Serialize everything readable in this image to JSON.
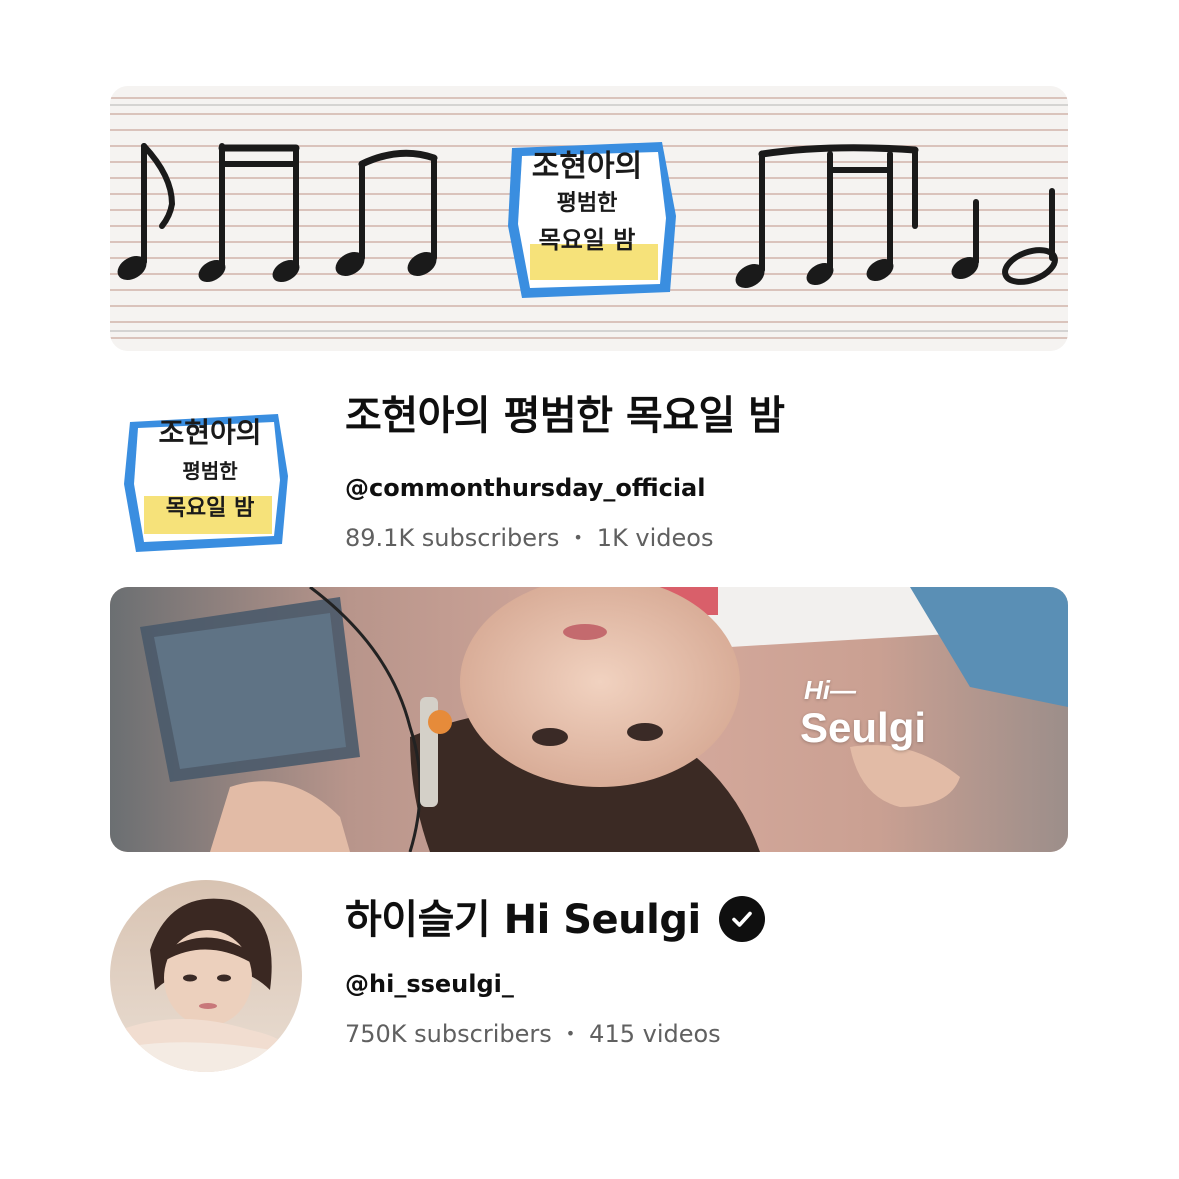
{
  "channels": [
    {
      "banner": {
        "logo_text_line1": "조현아의",
        "logo_text_line2": "평범한",
        "logo_text_line3": "목요일 밤"
      },
      "avatar": {
        "logo_text_line1": "조현아의",
        "logo_text_line2": "평범한",
        "logo_text_line3": "목요일 밤"
      },
      "title": "조현아의 평범한 목요일 밤",
      "handle": "@commonthursday_official",
      "subscribers": "89.1K subscribers",
      "videos": "1K videos",
      "separator": "•",
      "verified": false
    },
    {
      "banner": {
        "overlay_hi": "Hi—",
        "overlay_name": "Seulgi"
      },
      "title": "하이슬기 Hi Seulgi",
      "handle": "@hi_sseulgi_",
      "subscribers": "750K subscribers",
      "videos": "415 videos",
      "separator": "•",
      "verified": true,
      "verified_icon": "check-circle-icon"
    }
  ],
  "colors": {
    "text_primary": "#0f0f0f",
    "text_secondary": "#606060",
    "logo_blue": "#3a8ee0",
    "logo_yellow": "#f6e27a"
  }
}
